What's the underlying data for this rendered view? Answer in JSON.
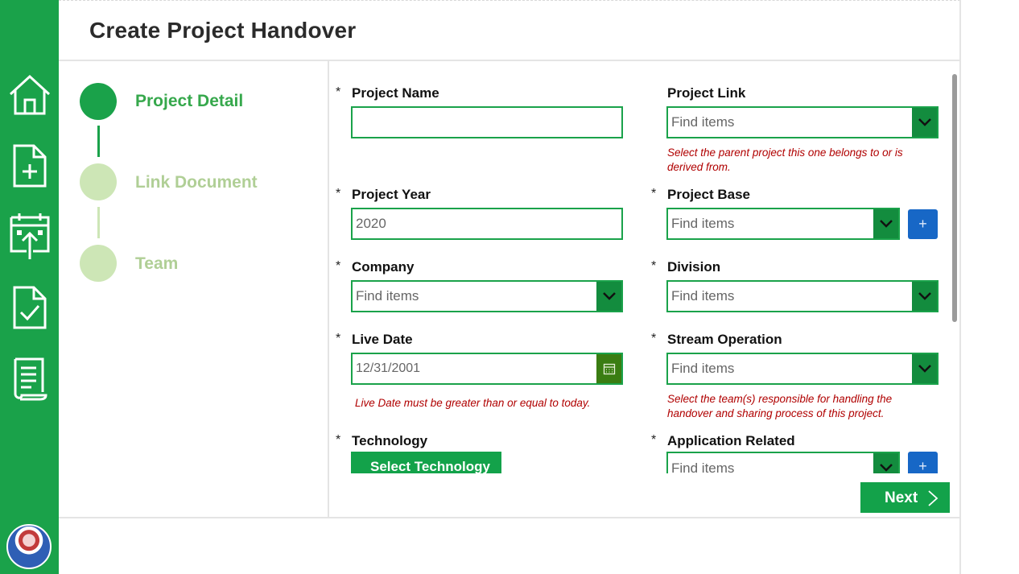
{
  "app": {
    "title": "Create Project Handover"
  },
  "steps": [
    {
      "label": "Project Detail",
      "state": "active",
      "dot_color": "#1aa24a",
      "text_color": "#36a84c"
    },
    {
      "label": "Link Document",
      "state": "pending",
      "dot_color": "#cde6b6",
      "text_color": "#b0cf96"
    },
    {
      "label": "Team",
      "state": "pending",
      "dot_color": "#cde6b6",
      "text_color": "#b0cf96"
    }
  ],
  "rail": {
    "icons": [
      "home-icon",
      "new-document-icon",
      "calendar-upload-icon",
      "document-check-icon",
      "report-scroll-icon"
    ],
    "accent": "#1aa24a"
  },
  "form": {
    "project_name": {
      "required": "*",
      "label": "Project Name",
      "value": ""
    },
    "project_link": {
      "label": "Project Link",
      "placeholder": "Find items",
      "hint": "Select the parent project this one belongs to or is derived from."
    },
    "project_year": {
      "required": "*",
      "label": "Project Year",
      "value": "2020"
    },
    "project_base": {
      "required": "*",
      "label": "Project Base",
      "placeholder": "Find items",
      "add": "+"
    },
    "company": {
      "required": "*",
      "label": "Company",
      "placeholder": "Find items"
    },
    "division": {
      "required": "*",
      "label": "Division",
      "placeholder": "Find items"
    },
    "live_date": {
      "required": "*",
      "label": "Live Date",
      "value": "12/31/2001",
      "hint": "Live Date must be greater than or equal to today."
    },
    "stream_operation": {
      "required": "*",
      "label": "Stream Operation",
      "placeholder": "Find items",
      "hint": "Select the team(s) responsible for handling the handover and sharing process of this project."
    },
    "technology": {
      "required": "*",
      "label": "Technology",
      "button": "Select Technology"
    },
    "application_related": {
      "required": "*",
      "label": "Application Related",
      "placeholder": "Find items",
      "add": "+"
    }
  },
  "actions": {
    "next": "Next"
  },
  "colors": {
    "primary_green": "#1aa24a",
    "dropdown_green": "#138c3e",
    "calendar_green": "#3a7d12",
    "hint_red": "#b00000",
    "add_blue": "#1767c6"
  }
}
